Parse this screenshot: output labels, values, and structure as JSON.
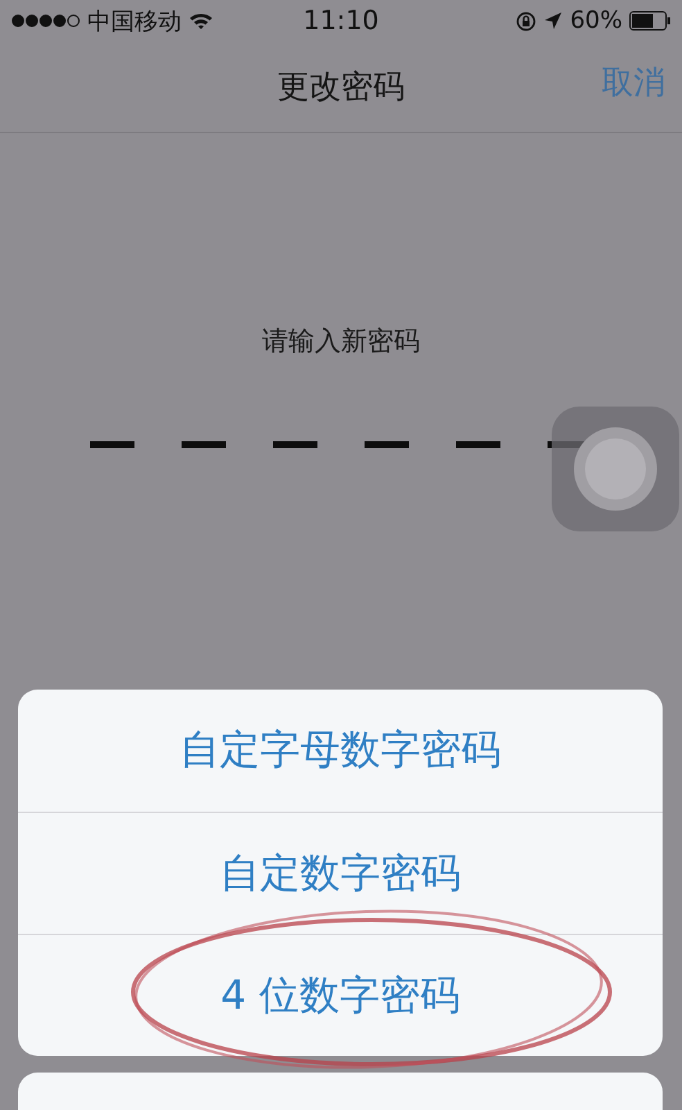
{
  "status_bar": {
    "carrier": "中国移动",
    "time": "11:10",
    "battery": "60%"
  },
  "nav": {
    "title": "更改密码",
    "cancel": "取消"
  },
  "prompt": "请输入新密码",
  "passcode_slots": [
    {
      "filled": false
    },
    {
      "filled": false
    },
    {
      "filled": false
    },
    {
      "filled": false
    },
    {
      "filled": false
    },
    {
      "filled": false
    }
  ],
  "action_sheet": {
    "options": [
      {
        "label": "自定字母数字密码",
        "circled": false
      },
      {
        "label": "自定数字密码",
        "circled": false
      },
      {
        "label": "4 位数字密码",
        "circled": true
      }
    ]
  }
}
